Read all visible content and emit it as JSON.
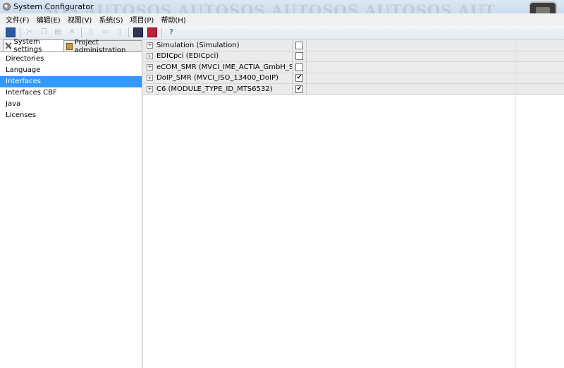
{
  "window": {
    "title": "System Configurator"
  },
  "watermark": "SOS AUTOSOS AUTOSOS AUTOSOS AUTOSOS AUT",
  "menu": [
    "文件(F)",
    "编辑(E)",
    "视图(V)",
    "系统(S)",
    "项目(P)",
    "帮助(H)"
  ],
  "toolbar": {
    "check_mark": "✔"
  },
  "tabs": {
    "system_settings": "System settings",
    "project_admin": "Project administration"
  },
  "nav": {
    "items": [
      "Directories",
      "Language",
      "Interfaces",
      "Interfaces CBF",
      "Java",
      "Licenses"
    ],
    "selected": "Interfaces"
  },
  "interfaces": {
    "expander": "+",
    "rows": [
      {
        "label": "Simulation (Simulation)",
        "checked": false,
        "mark": ""
      },
      {
        "label": "EDICpci (EDICpci)",
        "checked": false,
        "mark": ""
      },
      {
        "label": "eCOM_SMR (MVCI_IME_ACTIA_GmbH_SDconn...",
        "checked": false,
        "mark": ""
      },
      {
        "label": "DoIP_SMR (MVCI_ISO_13400_DoIP)",
        "checked": true,
        "mark": "✔"
      },
      {
        "label": "C6 (MODULE_TYPE_ID_MTS6532)",
        "checked": true,
        "mark": "✔"
      }
    ]
  },
  "colors": {
    "selection": "#3399ff",
    "row_bg": "#ebebeb"
  }
}
